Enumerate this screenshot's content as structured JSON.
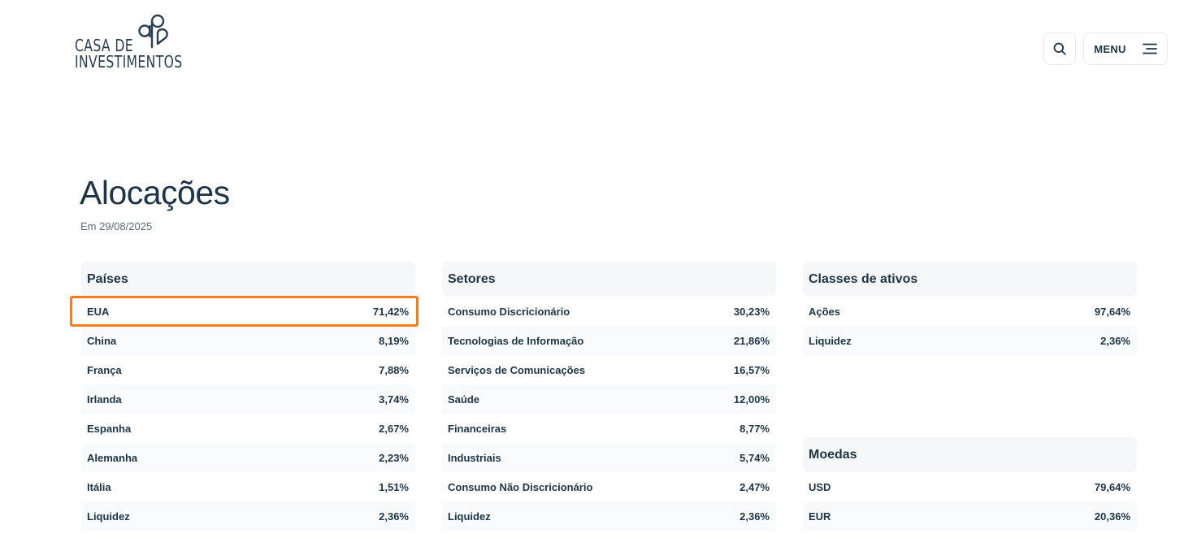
{
  "brand": {
    "line1": "CASA DE",
    "line2": "INVESTIMENTOS"
  },
  "header": {
    "menu_label": "MENU",
    "search_icon": "search-icon",
    "menu_icon": "hamburger-icon"
  },
  "page": {
    "title": "Alocações",
    "date": "Em 29/08/2025"
  },
  "colors": {
    "text": "#1e3547",
    "highlight": "#f47c20",
    "panel_header": "#f6f7f9"
  },
  "paises": {
    "title": "Países",
    "rows": [
      {
        "label": "EUA",
        "value": "71,42%"
      },
      {
        "label": "China",
        "value": "8,19%"
      },
      {
        "label": "França",
        "value": "7,88%"
      },
      {
        "label": "Irlanda",
        "value": "3,74%"
      },
      {
        "label": "Espanha",
        "value": "2,67%"
      },
      {
        "label": "Alemanha",
        "value": "2,23%"
      },
      {
        "label": "Itália",
        "value": "1,51%"
      },
      {
        "label": "Liquidez",
        "value": "2,36%"
      }
    ]
  },
  "setores": {
    "title": "Setores",
    "rows": [
      {
        "label": "Consumo Discricionário",
        "value": "30,23%"
      },
      {
        "label": "Tecnologias de Informação",
        "value": "21,86%"
      },
      {
        "label": "Serviços de Comunicações",
        "value": "16,57%"
      },
      {
        "label": "Saúde",
        "value": "12,00%"
      },
      {
        "label": "Financeiras",
        "value": "8,77%"
      },
      {
        "label": "Industriais",
        "value": "5,74%"
      },
      {
        "label": "Consumo Não Discricionário",
        "value": "2,47%"
      },
      {
        "label": "Liquidez",
        "value": "2,36%"
      }
    ]
  },
  "classes": {
    "title": "Classes de ativos",
    "rows": [
      {
        "label": "Ações",
        "value": "97,64%"
      },
      {
        "label": "Liquidez",
        "value": "2,36%"
      }
    ]
  },
  "moedas": {
    "title": "Moedas",
    "rows": [
      {
        "label": "USD",
        "value": "79,64%"
      },
      {
        "label": "EUR",
        "value": "20,36%"
      }
    ]
  }
}
